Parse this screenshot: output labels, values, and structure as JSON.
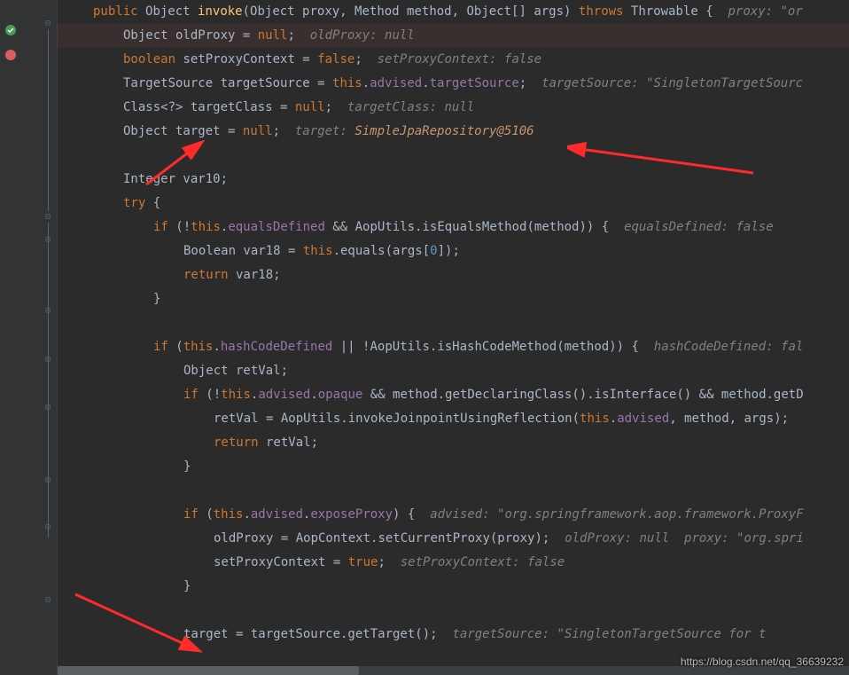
{
  "watermark": "https://blog.csdn.net/qq_36639232",
  "code": {
    "l1": {
      "kw1": "public",
      "type1": "Object ",
      "fn": "invoke",
      "params": "(Object proxy, Method method, Object[] args) ",
      "kw2": "throws",
      "type2": " Throwable {  ",
      "hint": "proxy: \"or"
    },
    "l2": {
      "type": "Object oldProxy = ",
      "kw": "null",
      "semi": ";  ",
      "hint": "oldProxy: null"
    },
    "l3": {
      "kw1": "boolean",
      "text": " setProxyContext = ",
      "kw2": "false",
      "semi": ";  ",
      "hint": "setProxyContext: false"
    },
    "l4": {
      "text1": "TargetSource targetSource = ",
      "kw": "this",
      "text2": ".",
      "field1": "advised",
      "text3": ".",
      "field2": "targetSource",
      "semi": ";  ",
      "hint": "targetSource: \"SingletonTargetSourc"
    },
    "l5": {
      "text1": "Class<?> targetClass = ",
      "kw": "null",
      "semi": ";  ",
      "hint": "targetClass: null"
    },
    "l6": {
      "text1": "Object target = ",
      "kw": "null",
      "semi": ";  ",
      "hint_label": "target: ",
      "hint_val": "SimpleJpaRepository@5106"
    },
    "l8": {
      "text1": "Integer var10;"
    },
    "l9": {
      "kw": "try",
      "text": " {"
    },
    "l10": {
      "kw1": "if",
      "text1": " (!",
      "kw2": "this",
      "text2": ".",
      "field1": "equalsDefined",
      "text3": " && AopUtils.",
      "fn": "isEqualsMethod",
      "text4": "(method)) {  ",
      "hint": "equalsDefined: false"
    },
    "l11": {
      "text1": "Boolean var18 = ",
      "kw": "this",
      "text2": ".equals(args[",
      "num": "0",
      "text3": "]);"
    },
    "l12": {
      "kw": "return",
      "text": " var18;"
    },
    "l13": {
      "text": "}"
    },
    "l15": {
      "kw1": "if",
      "text1": " (",
      "kw2": "this",
      "text2": ".",
      "field1": "hashCodeDefined",
      "text3": " || !AopUtils.",
      "fn": "isHashCodeMethod",
      "text4": "(method)) {  ",
      "hint": "hashCodeDefined: fal"
    },
    "l16": {
      "text": "Object retVal;"
    },
    "l17": {
      "kw1": "if",
      "text1": " (!",
      "kw2": "this",
      "text2": ".",
      "field1": "advised",
      "text3": ".",
      "field2": "opaque",
      "text4": " && method.getDeclaringClass().isInterface() && method.getD"
    },
    "l18": {
      "text1": "retVal = AopUtils.",
      "fn": "invokeJoinpointUsingReflection",
      "text2": "(",
      "kw": "this",
      "text3": ".",
      "field": "advised",
      "text4": ", method, args);"
    },
    "l19": {
      "kw": "return",
      "text": " retVal;"
    },
    "l20": {
      "text": "}"
    },
    "l22": {
      "kw1": "if",
      "text1": " (",
      "kw2": "this",
      "text2": ".",
      "field1": "advised",
      "text3": ".",
      "field2": "exposeProxy",
      "text4": ") {  ",
      "hint": "advised: \"org.springframework.aop.framework.ProxyF"
    },
    "l23": {
      "text1": "oldProxy = AopContext.",
      "fn": "setCurrentProxy",
      "text2": "(proxy);  ",
      "hint": "oldProxy: null  proxy: \"org.spri"
    },
    "l24": {
      "text1": "setProxyContext = ",
      "kw": "true",
      "semi": ";  ",
      "hint": "setProxyContext: false"
    },
    "l25": {
      "text": "}"
    },
    "l27": {
      "text1": "target = targetSource.getTarget();  ",
      "hint": "targetSource: \"SingletonTargetSource for t"
    }
  }
}
